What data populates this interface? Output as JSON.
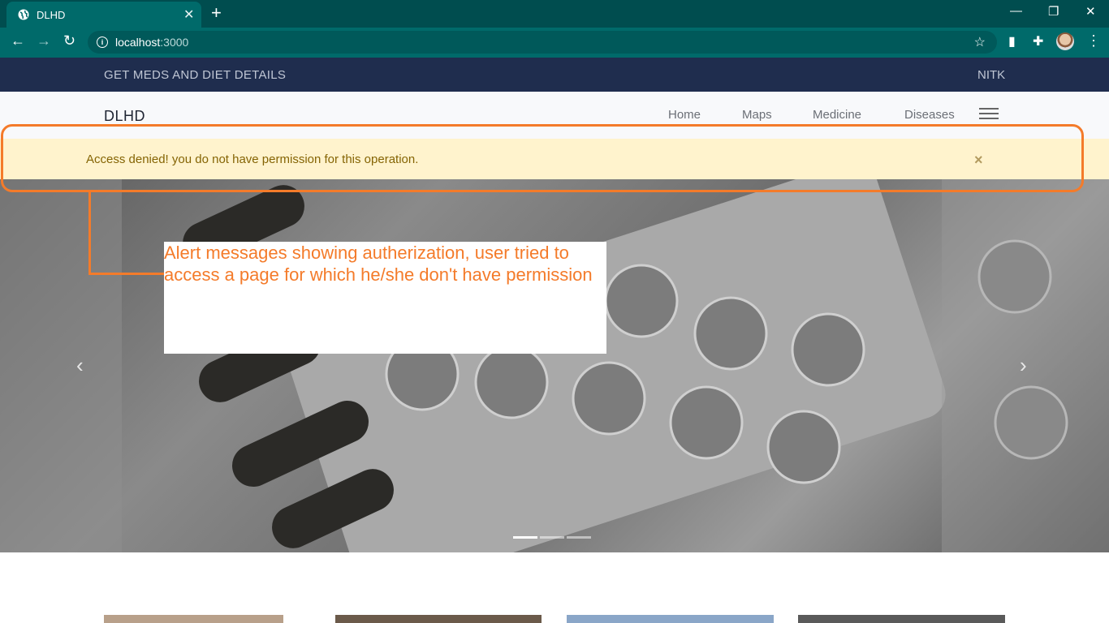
{
  "browser": {
    "tab_title": "DLHD",
    "url_host": "localhost",
    "url_port": ":3000",
    "icons": [
      "globe-icon",
      "close-icon",
      "plus-icon",
      "minimize-icon",
      "restore-icon",
      "window-close-icon",
      "back-icon",
      "forward-icon",
      "reload-icon",
      "info-icon",
      "star-icon",
      "extension-icon",
      "puzzle-icon",
      "avatar",
      "menu-icon"
    ]
  },
  "topbar": {
    "left_text": "GET MEDS AND DIET DETAILS",
    "right_text": "NITK"
  },
  "navbar": {
    "brand": "DLHD",
    "links": [
      "Home",
      "Maps",
      "Medicine",
      "Diseases"
    ]
  },
  "alert": {
    "message": "Access denied! you do not have permission for this operation.",
    "close_symbol": "×"
  },
  "annotation": {
    "text": "Alert messages showing autherization, user tried to access a page for which he/she don't have permission",
    "color": "#f47b2a"
  },
  "carousel": {
    "prev_symbol": "‹",
    "next_symbol": "›"
  }
}
